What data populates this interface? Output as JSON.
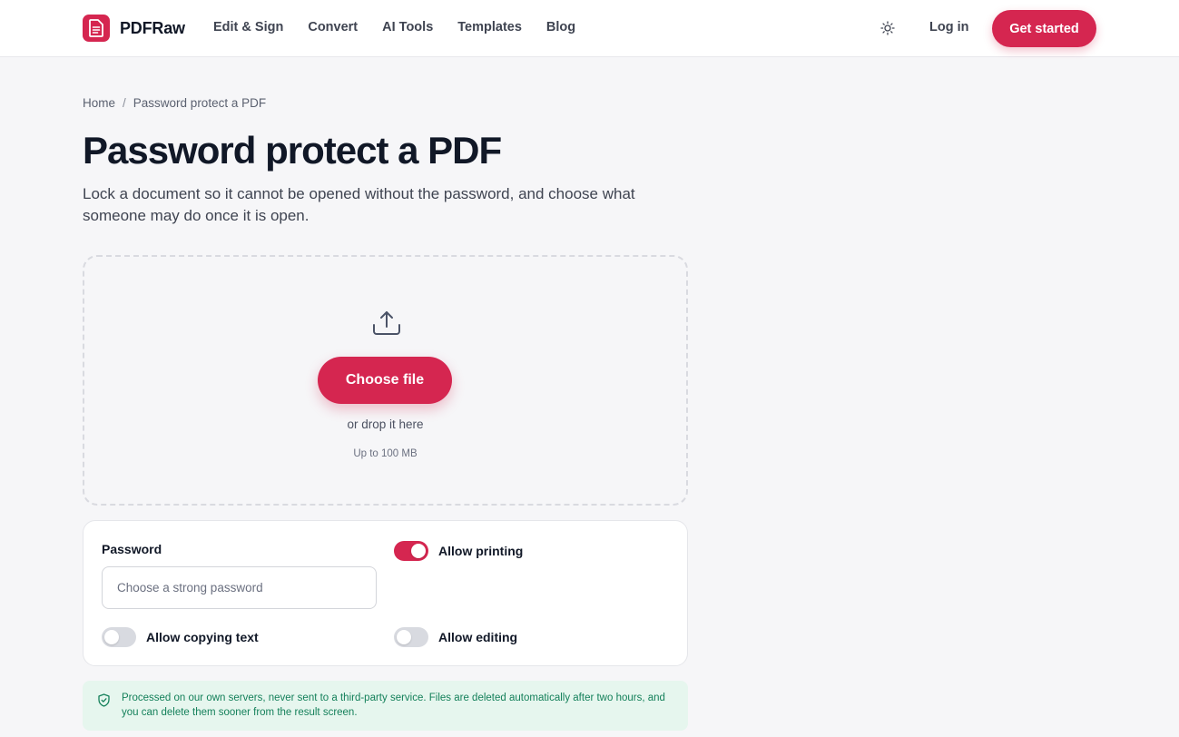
{
  "header": {
    "brand": "PDFRaw",
    "nav": [
      "Edit & Sign",
      "Convert",
      "AI Tools",
      "Templates",
      "Blog"
    ],
    "theme_icon": "sun-icon",
    "login_label": "Log in",
    "cta_label": "Get started"
  },
  "breadcrumb": {
    "home": "Home",
    "separator": "/",
    "current": "Password protect a PDF"
  },
  "page": {
    "title": "Password protect a PDF",
    "subtitle": "Lock a document so it cannot be opened without the password, and choose what someone may do once it is open."
  },
  "dropzone": {
    "icon": "upload-icon",
    "button_label": "Choose file",
    "hint": "or drop it here",
    "limit": "Up to 100 MB"
  },
  "options": {
    "password_label": "Password",
    "password_placeholder": "Choose a strong password",
    "password_value": "",
    "allow_printing": {
      "label": "Allow printing",
      "on": true
    },
    "allow_copying": {
      "label": "Allow copying text",
      "on": false
    },
    "allow_editing": {
      "label": "Allow editing",
      "on": false
    }
  },
  "notice": {
    "icon": "shield-check-icon",
    "text": "Processed on our own servers, never sent to a third-party service. Files are deleted automatically after two hours, and you can delete them sooner from the result screen."
  },
  "colors": {
    "accent": "#d52650",
    "notice_bg": "#e6f6ee",
    "notice_text": "#14805a"
  }
}
